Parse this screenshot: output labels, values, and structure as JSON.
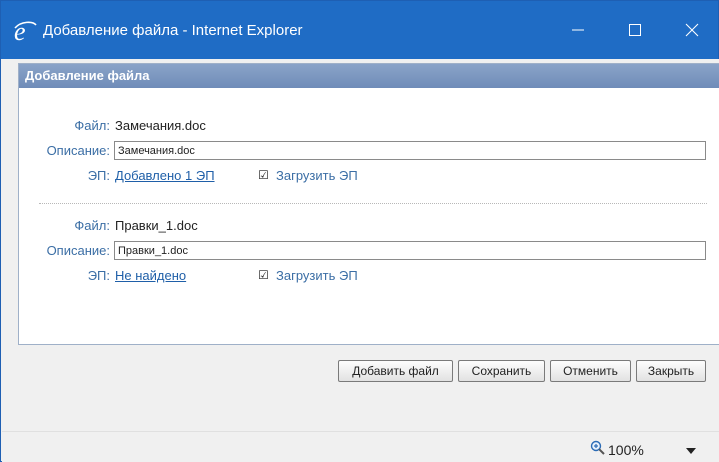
{
  "window": {
    "title": "Добавление файла - Internet Explorer"
  },
  "dialog": {
    "header": "Добавление файла",
    "files": [
      {
        "file_label": "Файл:",
        "file_name": "Замечания.doc",
        "desc_label": "Описание:",
        "desc_value": "Замечания.doc",
        "ep_label": "ЭП:",
        "ep_link": "Добавлено 1 ЭП",
        "upload_label": "Загрузить ЭП",
        "upload_checked": true
      },
      {
        "file_label": "Файл:",
        "file_name": "Правки_1.doc",
        "desc_label": "Описание:",
        "desc_value": "Правки_1.doc",
        "ep_label": "ЭП:",
        "ep_link": "Не найдено",
        "upload_label": "Загрузить ЭП",
        "upload_checked": true
      }
    ]
  },
  "buttons": {
    "add_file": "Добавить файл",
    "save": "Сохранить",
    "cancel": "Отменить",
    "close": "Закрыть"
  },
  "statusbar": {
    "zoom": "100%"
  },
  "colors": {
    "titlebar": "#1f6cc5",
    "dialog_header": "#7b96c0",
    "label": "#3b6ea5",
    "link": "#1f5fa8"
  }
}
